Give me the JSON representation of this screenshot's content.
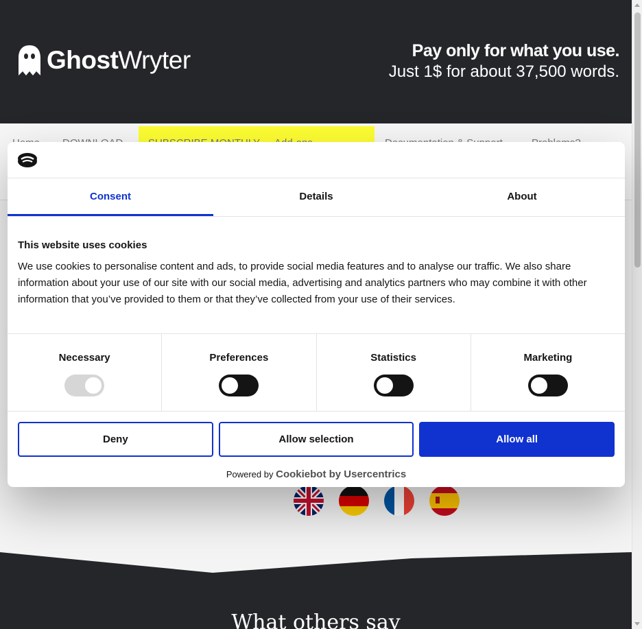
{
  "site": {
    "logo_text_bold": "Ghost",
    "logo_text_light": "Wryter",
    "tagline_line1": "Pay only for what you use.",
    "tagline_line2": "Just 1$ for about 37,500 words.",
    "nav": [
      "Home",
      "DOWNLOAD",
      "SUBSCRIBE MONTHLY",
      "Add-ons",
      "Documentation & Support",
      "Problems?"
    ],
    "section_heading": "What others say",
    "languages": [
      "English",
      "German",
      "French",
      "Spanish"
    ],
    "colors": {
      "header_bg": "#25262a",
      "nav_highlight": "#ffff33"
    }
  },
  "dialog": {
    "tabs": [
      "Consent",
      "Details",
      "About"
    ],
    "active_tab": "Consent",
    "heading": "This website uses cookies",
    "body": "We use cookies to personalise content and ads, to provide social media features and to analyse our traffic. We also share information about your use of our site with our social media, advertising and analytics partners who may combine it with other information that you’ve provided to them or that they’ve collected from your use of their services.",
    "toggles": [
      {
        "label": "Necessary",
        "enabled": true,
        "locked": true
      },
      {
        "label": "Preferences",
        "enabled": false
      },
      {
        "label": "Statistics",
        "enabled": false
      },
      {
        "label": "Marketing",
        "enabled": false
      }
    ],
    "deny_label": "Deny",
    "allow_selection_label": "Allow selection",
    "allow_all_label": "Allow all",
    "powered_prefix": "Powered by",
    "powered_brand": "Cookiebot by Usercentrics",
    "accent_color": "#1032cf"
  }
}
